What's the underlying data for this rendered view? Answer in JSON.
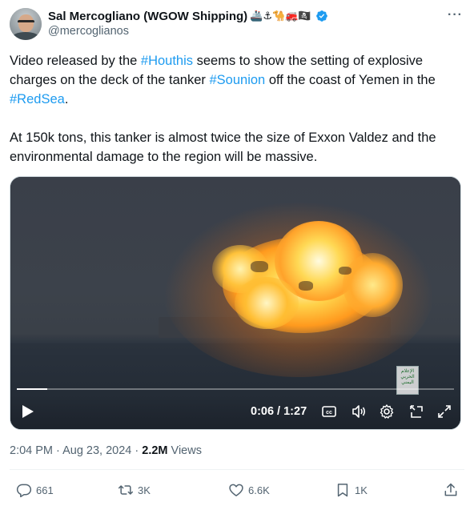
{
  "author": {
    "name": "Sal Mercogliano (WGOW Shipping)",
    "emojis": "🚢⚓🐪🚒🏴‍☠️",
    "handle": "@mercoglianos",
    "verified": true,
    "more_label": "···"
  },
  "tweet": {
    "p1_a": "Video released by the ",
    "tag1": "#Houthis",
    "p1_b": " seems to show the setting of explosive charges on the deck of the tanker ",
    "tag2": "#Sounion",
    "p1_c": " off the coast of Yemen in the ",
    "tag3": "#RedSea",
    "p1_d": ".",
    "p2": "At 150k tons, this tanker is almost twice the size of Exxon Valdez and the environmental damage to the region will be massive."
  },
  "video": {
    "time": "0:06 / 1:27",
    "progress": 0.069,
    "watermark": "الإعلام الحربي اليمني",
    "cc_label": "cc"
  },
  "meta": {
    "time": "2:04 PM · Aug 23, 2024 · ",
    "views_count": "2.2M",
    "views_label": " Views"
  },
  "actions": {
    "replies": "661",
    "reposts": "3K",
    "likes": "6.6K",
    "bookmarks": "1K"
  },
  "colors": {
    "link": "#1d9bf0",
    "secondary": "#536471",
    "verified": "#1d9bf0"
  }
}
